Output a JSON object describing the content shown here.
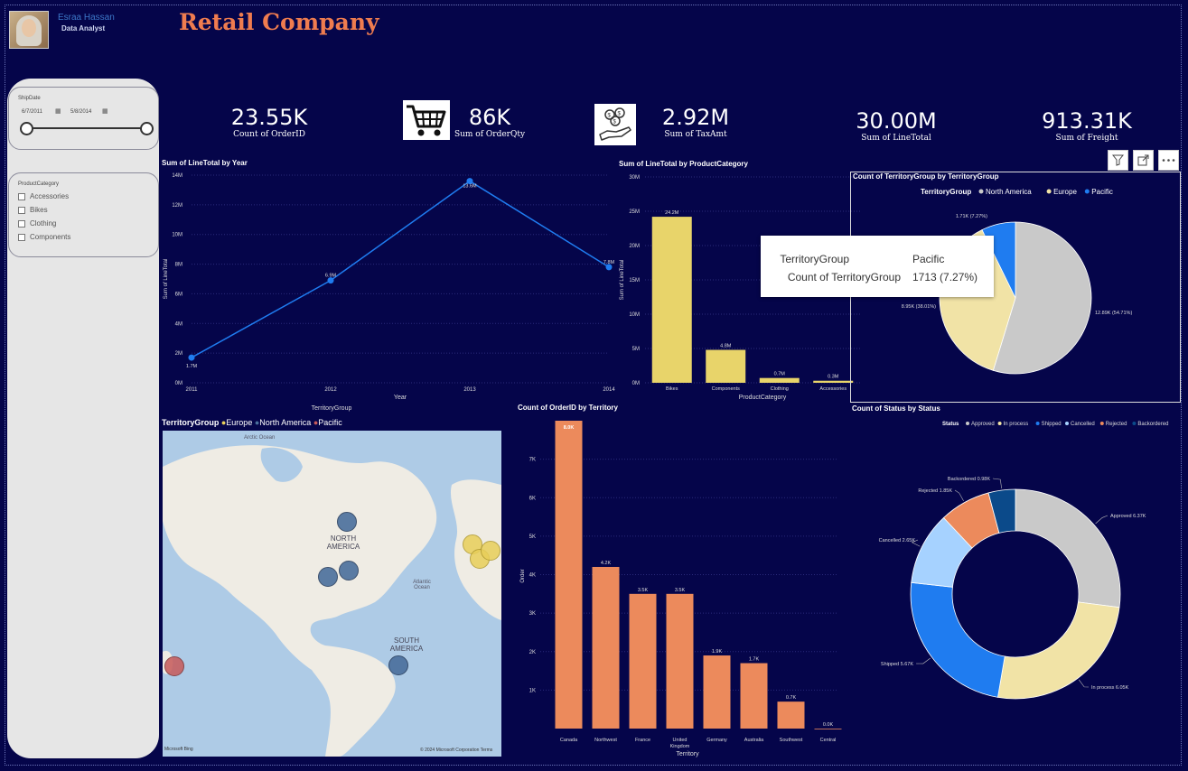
{
  "user": {
    "name": "Esraa Hassan",
    "role": "Data Analyst"
  },
  "title": "Retail Company",
  "slicers": {
    "shipdate": {
      "label": "ShipDate",
      "start": "6/7/2011",
      "end": "5/8/2014"
    },
    "category": {
      "label": "ProductCategory",
      "items": [
        "Accessories",
        "Bikes",
        "Clothing",
        "Components"
      ]
    }
  },
  "kpis": [
    {
      "value": "23.55K",
      "label": "Count of OrderID"
    },
    {
      "value": "86K",
      "label": "Sum of OrderQty",
      "icon": "cart-icon"
    },
    {
      "value": "2.92M",
      "label": "Sum of TaxAmt",
      "icon": "money-hand-icon"
    },
    {
      "value": "30.00M",
      "label": "Sum of LineTotal"
    },
    {
      "value": "913.31K",
      "label": "Sum of Freight"
    }
  ],
  "chart_data": [
    {
      "type": "line",
      "title": "Sum of LineTotal by Year",
      "xlabel": "Year",
      "ylabel": "Sum of LineTotal",
      "x": [
        "2011",
        "2012",
        "2013",
        "2014"
      ],
      "values": [
        1.7,
        6.9,
        13.6,
        7.8
      ],
      "data_labels": [
        "1.7M",
        "6.9M",
        "13.6M",
        "7.8M"
      ],
      "yticks": [
        "0M",
        "2M",
        "4M",
        "6M",
        "8M",
        "10M",
        "12M",
        "14M"
      ],
      "ylim": [
        0,
        14
      ],
      "color": "#1f7cf0",
      "extra_label": "TerritoryGroup"
    },
    {
      "type": "bar",
      "title": "Sum of LineTotal by ProductCategory",
      "xlabel": "ProductCategory",
      "ylabel": "Sum of LineTotal",
      "categories": [
        "Bikes",
        "Components",
        "Clothing",
        "Accessories"
      ],
      "values": [
        24.2,
        4.8,
        0.7,
        0.3
      ],
      "data_labels": [
        "24.2M",
        "4.8M",
        "0.7M",
        "0.3M"
      ],
      "yticks": [
        "0M",
        "5M",
        "10M",
        "15M",
        "20M",
        "25M",
        "30M"
      ],
      "ylim": [
        0,
        30
      ],
      "color": "#e8d46a"
    },
    {
      "type": "pie",
      "title": "Count of TerritoryGroup by TerritoryGroup",
      "legend_title": "TerritoryGroup",
      "labels": [
        "North America",
        "Europe",
        "Pacific"
      ],
      "values": [
        12890,
        8950,
        1710
      ],
      "data_labels": [
        "12.89K (54.71%)",
        "8.95K (38.01%)",
        "1.71K (7.27%)"
      ],
      "colors": [
        "#c9c9c9",
        "#f1e3a6",
        "#1f7cf0"
      ]
    },
    {
      "type": "bar",
      "title": "Count of OrderID by Territory",
      "xlabel": "Territory",
      "ylabel": "Order",
      "categories": [
        "Canada",
        "Northwest",
        "France",
        "United Kingdom",
        "Germany",
        "Australia",
        "Southwest",
        "Central"
      ],
      "values": [
        8.0,
        4.2,
        3.5,
        3.5,
        1.9,
        1.7,
        0.7,
        0.0
      ],
      "data_labels": [
        "8.0K",
        "4.2K",
        "3.5K",
        "3.5K",
        "1.9K",
        "1.7K",
        "0.7K",
        "0.0K"
      ],
      "yticks": [
        "1K",
        "2K",
        "3K",
        "4K",
        "5K",
        "6K",
        "7K"
      ],
      "ylim": [
        0,
        8
      ],
      "color": "#ec8a5c"
    },
    {
      "type": "pie",
      "subtype": "donut",
      "title": "Count of Status by Status",
      "legend_title": "Status",
      "labels": [
        "Approved",
        "In process",
        "Shipped",
        "Cancelled",
        "Rejected",
        "Backordered"
      ],
      "values": [
        6370,
        6050,
        5670,
        2650,
        1850,
        980
      ],
      "data_labels": [
        "Approved 6.37K",
        "In process 6.05K",
        "Shipped 5.67K",
        "Cancelled 2.65K",
        "Rejected 1.85K",
        "Backordered 0.98K"
      ],
      "colors": [
        "#c9c9c9",
        "#f1e3a6",
        "#1f7cf0",
        "#a6d2ff",
        "#ec8a5c",
        "#0b4a8a"
      ]
    }
  ],
  "map": {
    "legend_title": "TerritoryGroup",
    "legend": [
      {
        "label": "Europe",
        "color": "#e8cf5a"
      },
      {
        "label": "North America",
        "color": "#4a6f9c"
      },
      {
        "label": "Pacific",
        "color": "#c75a5a"
      }
    ],
    "place_labels": [
      "Arctic Ocean",
      "NORTH AMERICA",
      "SOUTH AMERICA",
      "Atlantic Ocean"
    ],
    "attribution": "© 2024 Microsoft Corporation Terms",
    "bing": "Microsoft Bing"
  },
  "tooltip": {
    "rows": [
      {
        "key": "TerritoryGroup",
        "value": "Pacific"
      },
      {
        "key": "Count of TerritoryGroup",
        "value": "1713 (7.27%)"
      }
    ]
  },
  "visual_buttons": [
    "filter-icon",
    "focus-mode-icon",
    "more-options-icon"
  ]
}
